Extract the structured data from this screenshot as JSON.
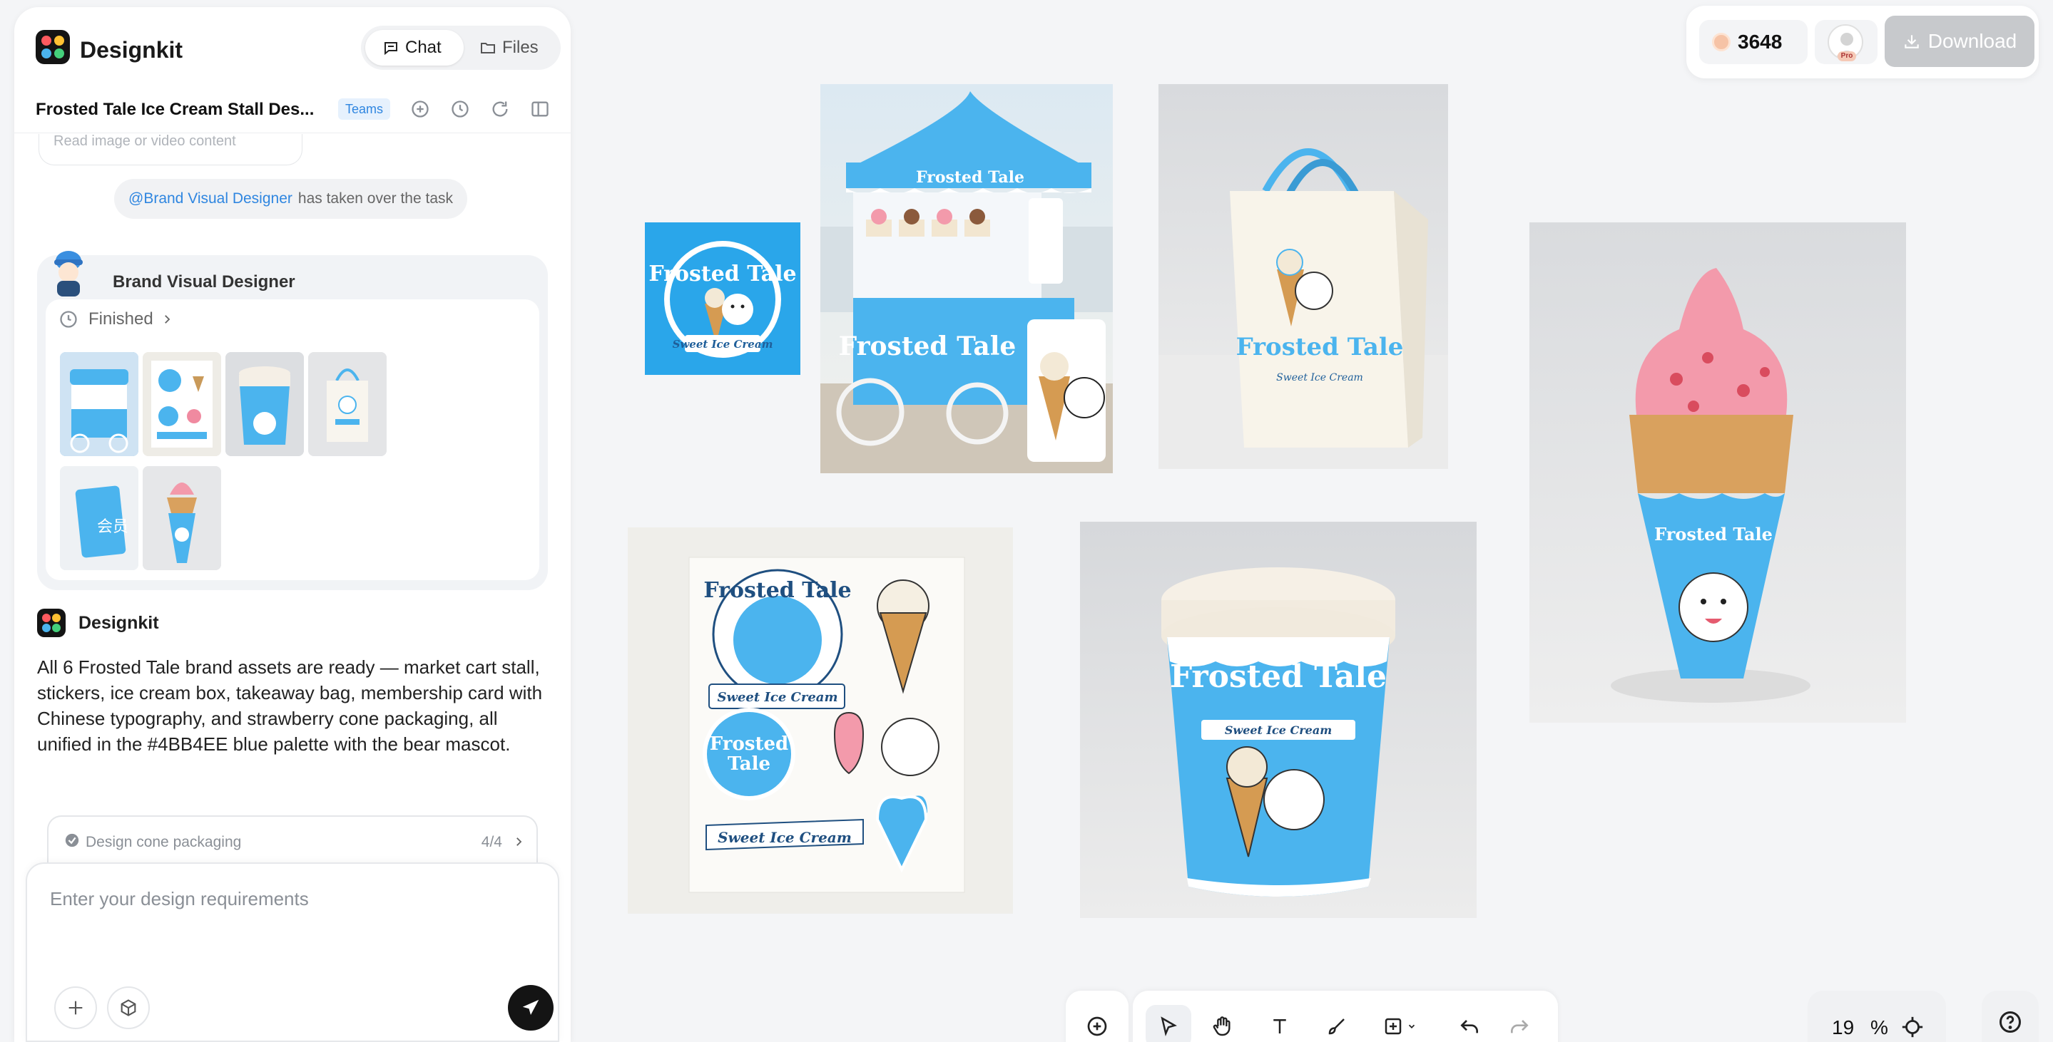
{
  "app": {
    "name": "Designkit",
    "tabs": [
      {
        "label": "Chat"
      },
      {
        "label": "Files"
      }
    ]
  },
  "task": {
    "title": "Frosted Tale Ice Cream Stall Des...",
    "badge": "Teams"
  },
  "chat": {
    "ghost_text": "Read image or video content",
    "takeover_mention": "@Brand Visual Designer",
    "takeover_text": "has taken over the task",
    "agent_name": "Brand Visual Designer",
    "status": "Finished",
    "assistant_name": "Designkit",
    "message": "All 6 Frosted Tale brand assets are ready — market cart stall, stickers, ice cream box, takeaway bag, membership card with Chinese typography, and strawberry cone packaging, all unified in the #4BB4EE blue palette with the bear mascot.",
    "step_label": "Design cone packaging",
    "step_count": "4/4",
    "input_placeholder": "Enter your design requirements"
  },
  "header": {
    "credits": "3648",
    "pro_label": "Pro",
    "download_label": "Download"
  },
  "canvas": {
    "brand_name": "Frosted Tale",
    "tagline": "Sweet Ice Cream",
    "card_chinese": "会员",
    "zoom": "19",
    "zoom_unit": "%"
  },
  "colors": {
    "brand_blue": "#4BB4EE",
    "accent_link": "#2F86E0"
  },
  "icons": [
    "chat-icon",
    "folder-icon",
    "add-circle-icon",
    "history-icon",
    "refresh-icon",
    "panel-icon",
    "clock-icon",
    "chevron-right-icon",
    "check-circle-icon",
    "plus-icon",
    "cube-icon",
    "send-icon",
    "download-icon",
    "add-location-icon",
    "pointer-icon",
    "hand-icon",
    "text-icon",
    "brush-icon",
    "add-box-icon",
    "undo-icon",
    "redo-icon",
    "focus-icon",
    "help-icon"
  ]
}
